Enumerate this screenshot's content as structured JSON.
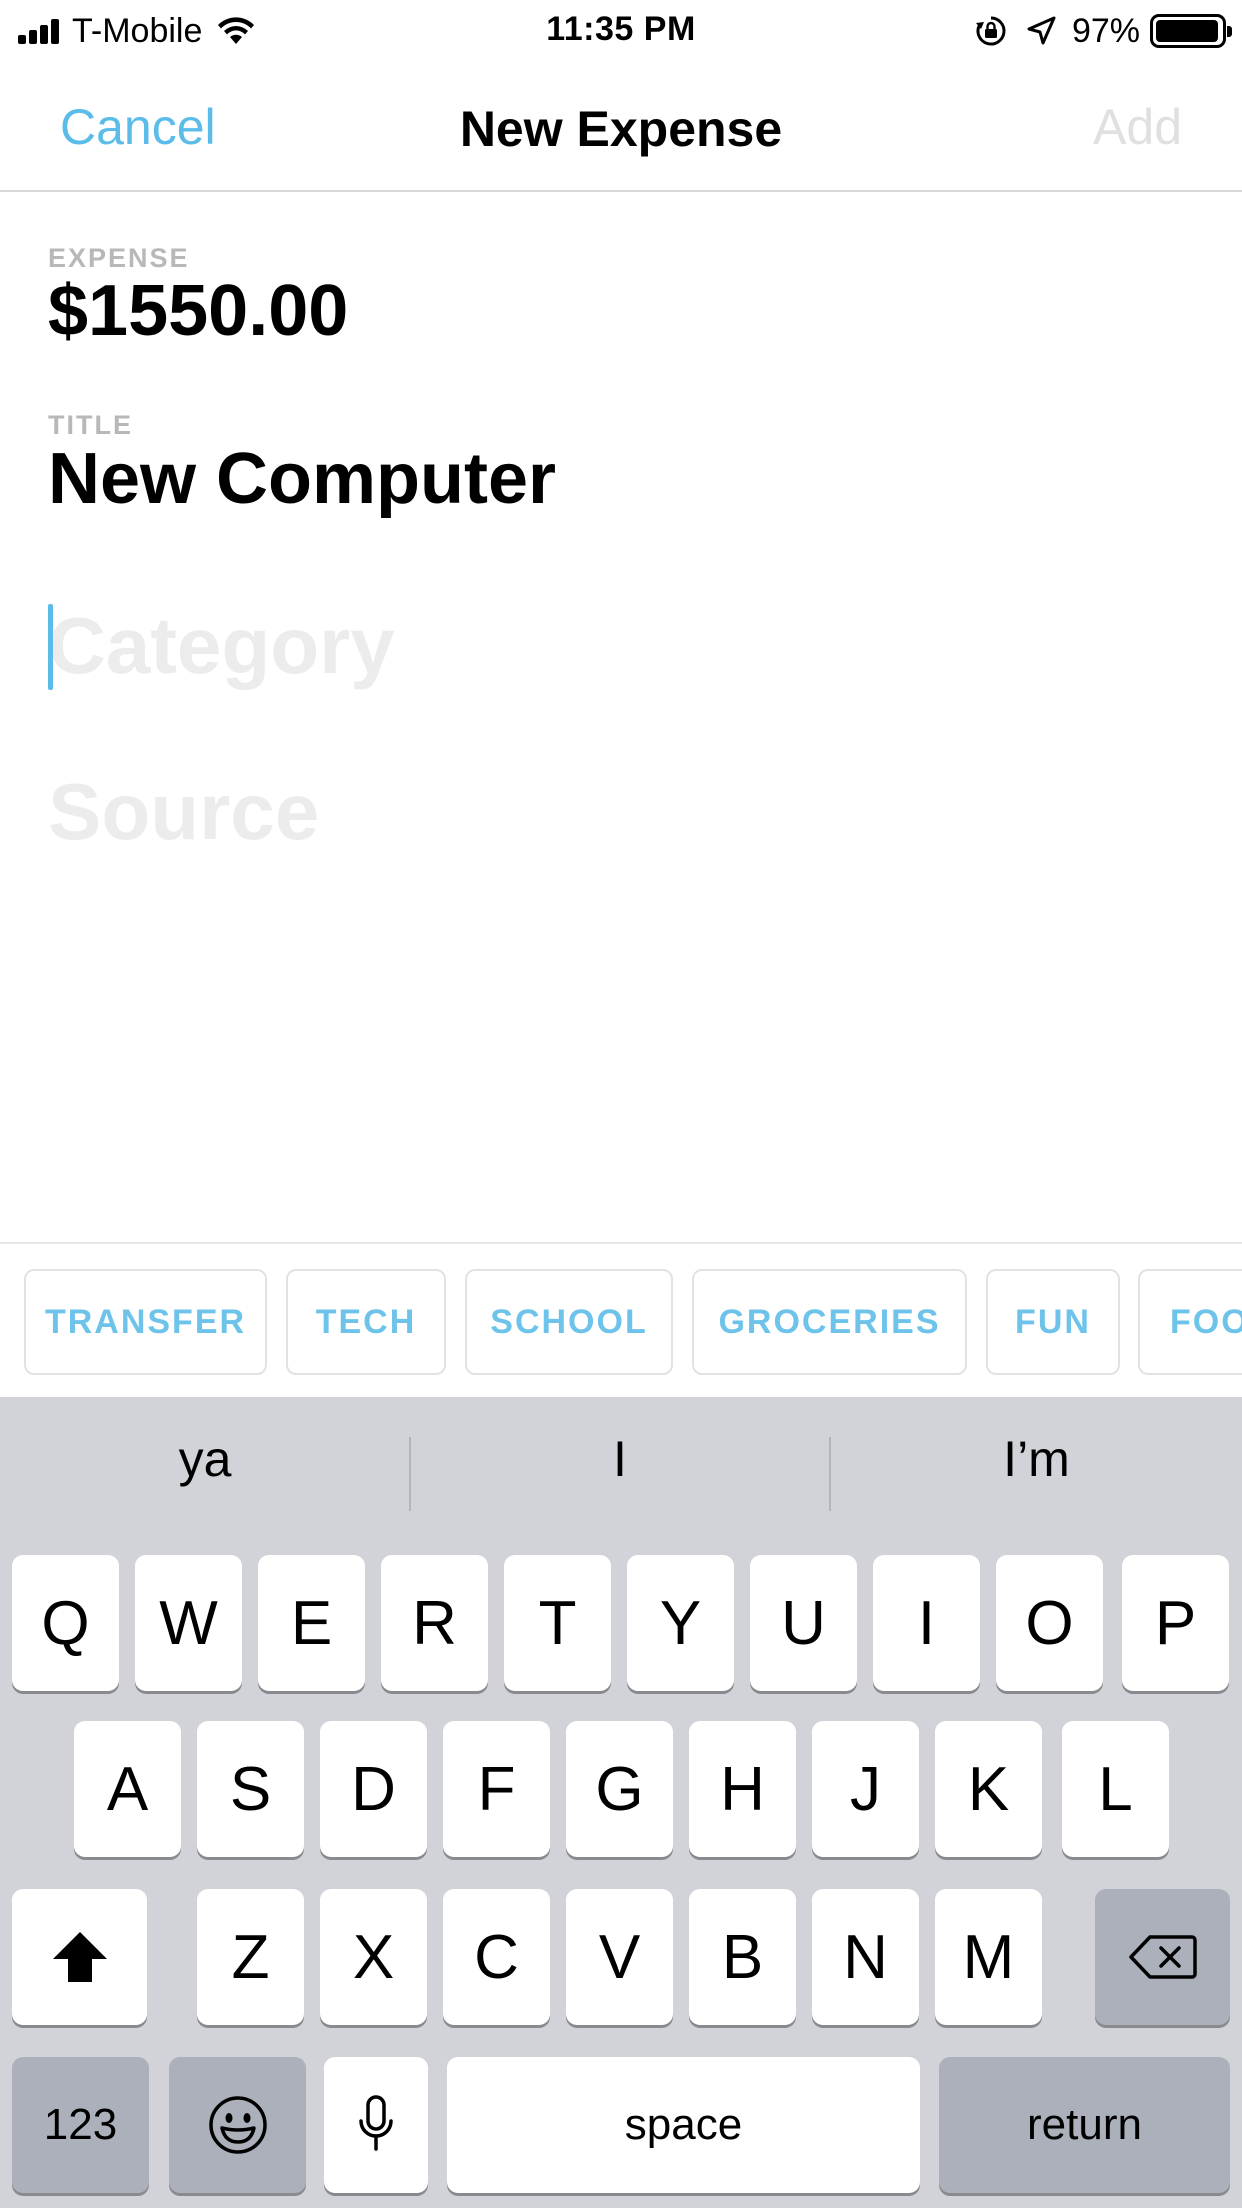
{
  "status_bar": {
    "carrier": "T-Mobile",
    "time": "11:35 PM",
    "battery": "97%",
    "battery_level": 0.97
  },
  "nav": {
    "cancel_label": "Cancel",
    "title": "New Expense",
    "add_label": "Add"
  },
  "form": {
    "expense_label": "EXPENSE",
    "expense_value": "$1550.00",
    "title_label": "TITLE",
    "title_value": "New Computer",
    "category_placeholder": "Category",
    "source_placeholder": "Source"
  },
  "categories": [
    "TRANSFER",
    "TECH",
    "SCHOOL",
    "GROCERIES",
    "FUN",
    "FOOD"
  ],
  "keyboard": {
    "suggestions": [
      "ya",
      "I",
      "I’m"
    ],
    "row1": [
      "Q",
      "W",
      "E",
      "R",
      "T",
      "Y",
      "U",
      "I",
      "O",
      "P"
    ],
    "row2": [
      "A",
      "S",
      "D",
      "F",
      "G",
      "H",
      "J",
      "K",
      "L"
    ],
    "row3": [
      "Z",
      "X",
      "C",
      "V",
      "B",
      "N",
      "M"
    ],
    "numbers_label": "123",
    "space_label": "space",
    "return_label": "return"
  },
  "colors": {
    "accent": "#5bbcea",
    "chip_text": "#6ec3eb",
    "placeholder": "#ececec",
    "keyboard_bg": "#d1d3d9"
  }
}
